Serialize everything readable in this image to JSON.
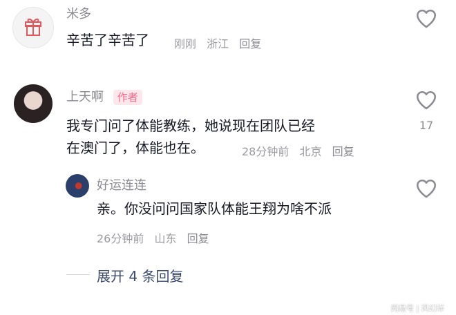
{
  "comments": [
    {
      "name": "米多",
      "content": "辛苦了辛苦了",
      "time": "刚刚",
      "location": "浙江",
      "reply_label": "回复"
    },
    {
      "name": "上天啊",
      "badge": "作者",
      "content_line1": "我专门问了体能教练，她说现在团队已经",
      "content_line2": "在澳门了，体能也在。",
      "time": "28分钟前",
      "location": "北京",
      "reply_label": "回复",
      "like_count": "17"
    },
    {
      "name": "好运连连",
      "content": "亲。你没问问国家队体能王翔为啥不派",
      "time": "26分钟前",
      "location": "山东",
      "reply_label": "回复"
    }
  ],
  "expand_label": "展开 4 条回复",
  "watermark": "网易号 | 风幻洋",
  "colors": {
    "accent_badge": "#f56a8c",
    "expand_text": "#3c4a6c",
    "meta_text": "#9a9ba1"
  },
  "icons": [
    "gift-icon",
    "heart-outline-icon"
  ]
}
